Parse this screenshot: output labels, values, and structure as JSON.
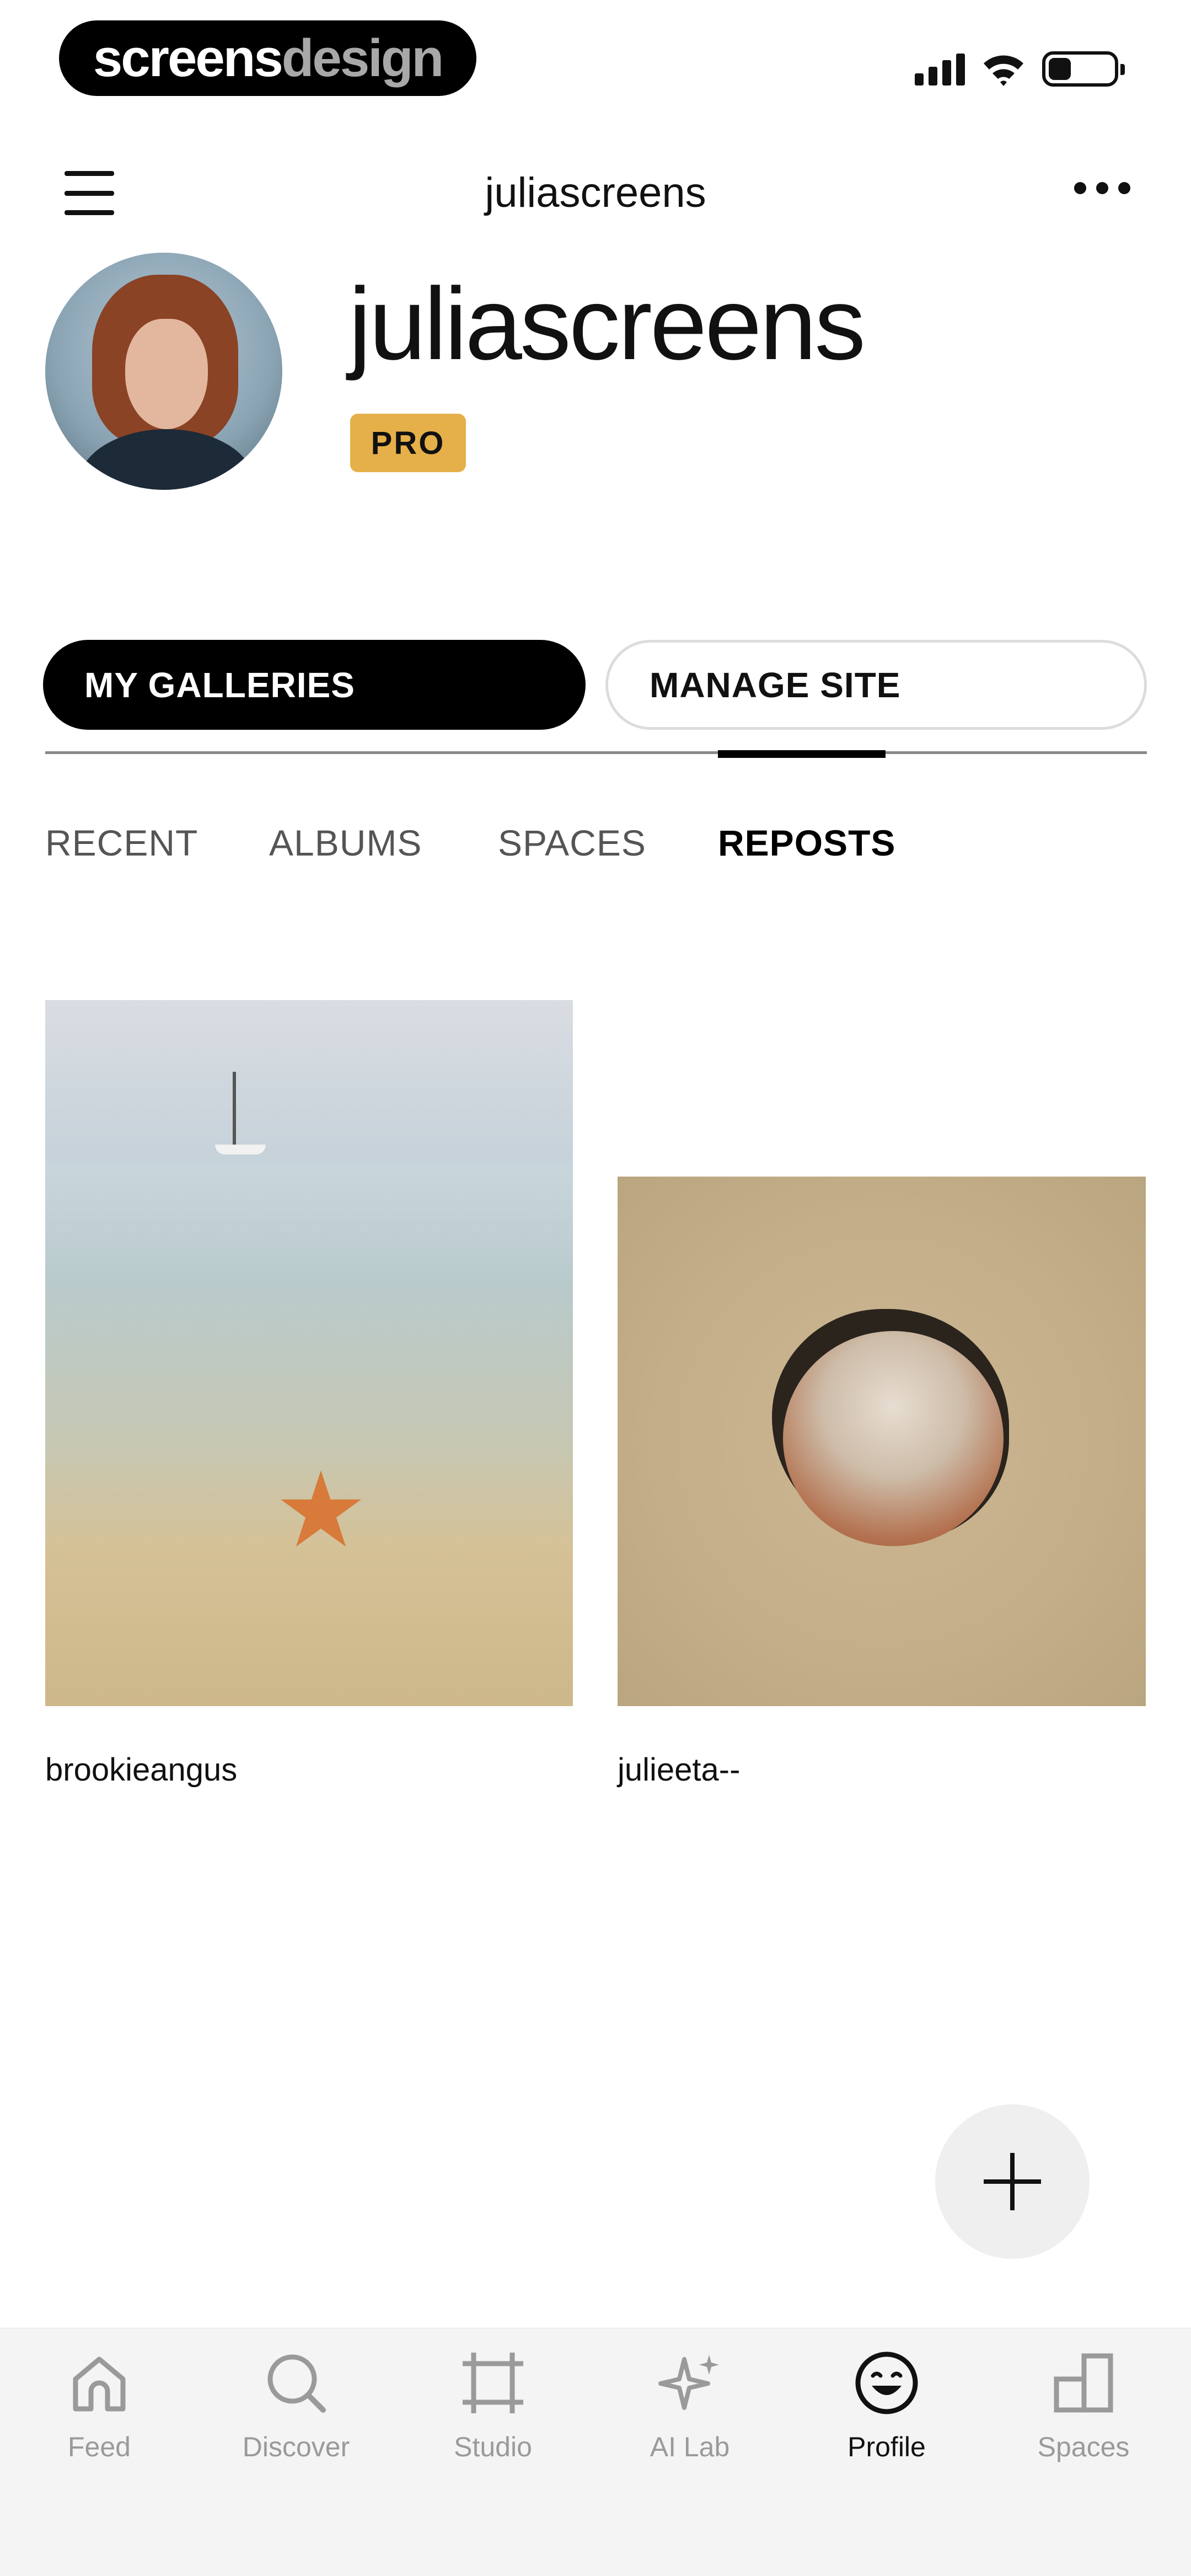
{
  "status_bar": {
    "brand_part1": "screens",
    "brand_part2": "design",
    "icons": [
      "signal-icon",
      "wifi-icon",
      "battery-icon"
    ]
  },
  "top_nav": {
    "title": "juliascreens",
    "menu_icon": "hamburger-menu-icon",
    "more_icon": "more-options-icon"
  },
  "profile": {
    "name": "juliascreens",
    "badge": "PRO"
  },
  "actions": {
    "my_galleries": "MY GALLERIES",
    "manage_site": "MANAGE SITE"
  },
  "tabs": [
    {
      "label": "RECENT",
      "active": false
    },
    {
      "label": "ALBUMS",
      "active": false
    },
    {
      "label": "SPACES",
      "active": false
    },
    {
      "label": "REPOSTS",
      "active": true
    }
  ],
  "gallery": [
    {
      "author": "brookieangus"
    },
    {
      "author": "julieeta--"
    }
  ],
  "fab": {
    "icon": "plus-icon"
  },
  "bottom_nav": [
    {
      "label": "Feed",
      "icon": "home-icon",
      "active": false
    },
    {
      "label": "Discover",
      "icon": "search-icon",
      "active": false
    },
    {
      "label": "Studio",
      "icon": "crop-icon",
      "active": false
    },
    {
      "label": "AI Lab",
      "icon": "sparkle-icon",
      "active": false
    },
    {
      "label": "Profile",
      "icon": "smiley-icon",
      "active": true
    },
    {
      "label": "Spaces",
      "icon": "spaces-icon",
      "active": false
    }
  ],
  "colors": {
    "accent_badge": "#E5B04A",
    "primary": "#000000",
    "inactive": "#9A9A9A"
  }
}
